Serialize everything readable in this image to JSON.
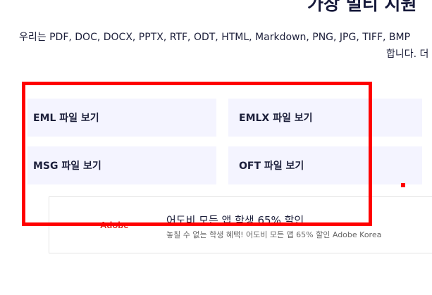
{
  "header": {
    "title": "가장 멀티 지원",
    "description_line1": "우리는 PDF, DOC, DOCX, PPTX, RTF, ODT, HTML, Markdown, PNG, JPG, TIFF, BMP",
    "description_line2": "합니다. 더"
  },
  "tiles": [
    {
      "label": "EML 파일 보기"
    },
    {
      "label": "EMLX 파일 보기"
    },
    {
      "label": "MSG 파일 보기"
    },
    {
      "label": "OFT 파일 보기"
    }
  ],
  "ad": {
    "logo_text": "Adobe",
    "title": "어도비 모든 앱 학생 65% 할인",
    "subtitle": "놓칠 수 없는 학생 혜택! 어도비 모든 앱 65% 할인 Adobe Korea"
  },
  "colors": {
    "highlight": "#ff0000",
    "tile_background": "#f4f4ff",
    "text": "#1c1f3a",
    "adobe_red": "#e1261c"
  }
}
